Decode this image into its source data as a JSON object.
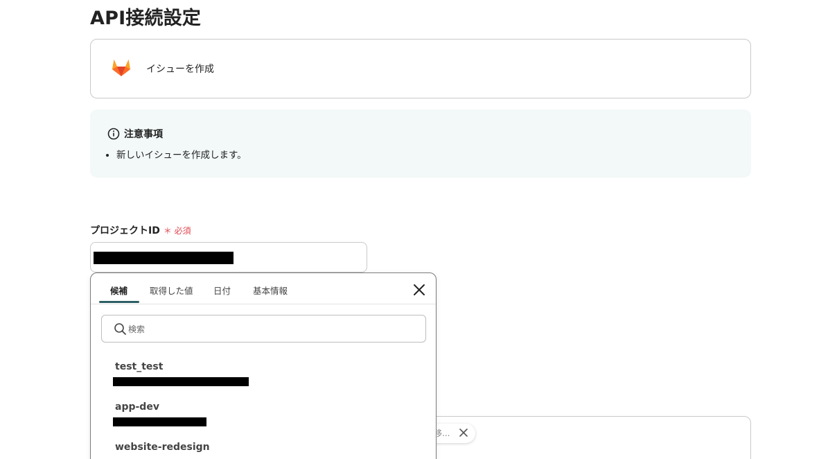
{
  "page_title": "API接続設定",
  "action": {
    "label": "イシューを作成",
    "logo_icon": "gitlab-icon"
  },
  "notice": {
    "title": "注意事項",
    "items": [
      "新しいイシューを作成します。"
    ]
  },
  "project_field": {
    "label": "プロジェクトID",
    "required_mark": "＊ 必須"
  },
  "picker": {
    "tabs": [
      {
        "label": "候補",
        "active": true
      },
      {
        "label": "取得した値",
        "active": false
      },
      {
        "label": "日付",
        "active": false
      },
      {
        "label": "基本情報",
        "active": false
      }
    ],
    "search_placeholder": "検索",
    "options": [
      {
        "name": "test_test"
      },
      {
        "name": "app-dev"
      },
      {
        "name": "website-redesign"
      }
    ]
  },
  "chip": {
    "text": "移..."
  },
  "colors": {
    "accent": "#2d5f64",
    "required": "#e0454f",
    "notice_bg": "#f3f8f8"
  }
}
